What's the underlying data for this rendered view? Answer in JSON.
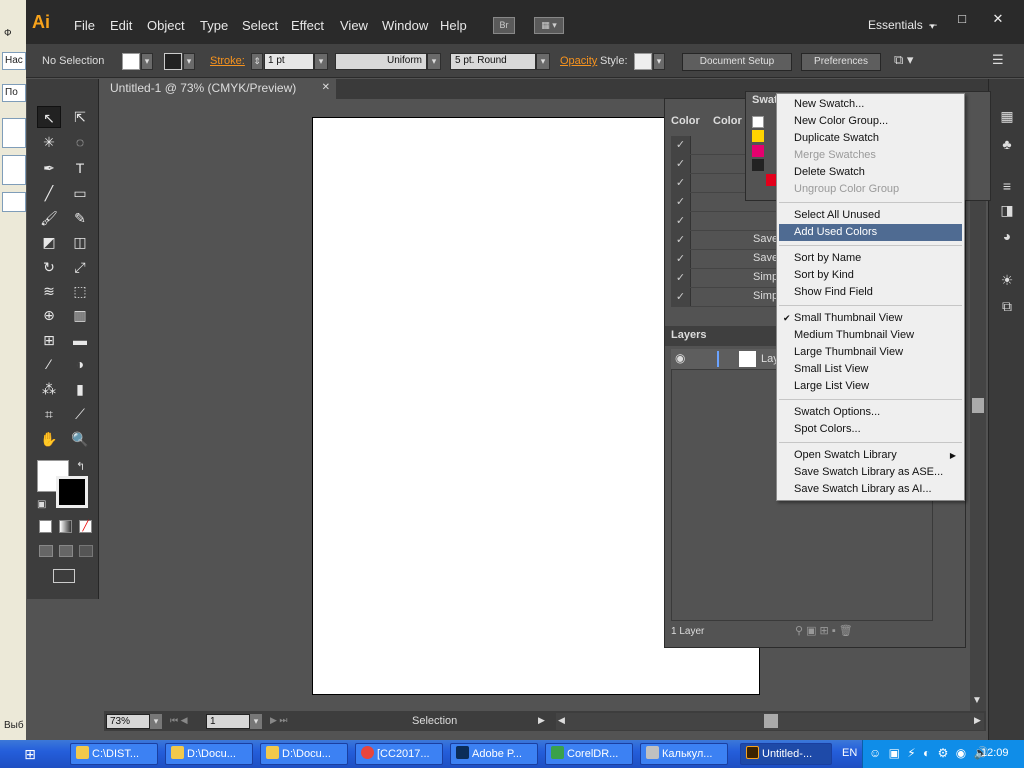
{
  "background_window": {
    "left_labels": [
      "Ф",
      "Нас",
      "По",
      "Выб"
    ]
  },
  "app": {
    "logo": "Ai",
    "menu": [
      "File",
      "Edit",
      "Object",
      "Type",
      "Select",
      "Effect",
      "View",
      "Window",
      "Help"
    ],
    "bridge_label": "Br",
    "workspace": "Essentials",
    "window_controls": [
      "_",
      "□",
      "✕"
    ]
  },
  "control_bar": {
    "selection": "No Selection",
    "stroke_label": "Stroke:",
    "stroke_value": "1 pt",
    "profile": "Uniform",
    "brush": "5 pt. Round",
    "opacity_label": "Opacity",
    "style_label": "Style:",
    "document_setup": "Document Setup",
    "preferences": "Preferences"
  },
  "document": {
    "tab_title": "Untitled-1 @ 73% (CMYK/Preview)",
    "close": "✕"
  },
  "status_bar": {
    "zoom": "73%",
    "page": "1",
    "tool": "Selection"
  },
  "panels": {
    "tab_color": "Color",
    "tab_color_guide": "Color",
    "tab_swatches": "Swat",
    "rows": [
      "",
      "",
      "",
      "",
      "",
      "Save",
      "Save",
      "Simp",
      "Simp"
    ],
    "layers_title": "Layers",
    "layer_name": "Lay",
    "layers_count": "1 Layer"
  },
  "context_menu": {
    "items": [
      {
        "label": "New Swatch...",
        "state": "normal"
      },
      {
        "label": "New Color Group...",
        "state": "normal"
      },
      {
        "label": "Duplicate Swatch",
        "state": "normal"
      },
      {
        "label": "Merge Swatches",
        "state": "disabled"
      },
      {
        "label": "Delete Swatch",
        "state": "normal"
      },
      {
        "label": "Ungroup Color Group",
        "state": "disabled"
      },
      {
        "label": "Select All Unused",
        "state": "normal"
      },
      {
        "label": "Add Used Colors",
        "state": "highlighted"
      },
      {
        "label": "Sort by Name",
        "state": "normal"
      },
      {
        "label": "Sort by Kind",
        "state": "normal"
      },
      {
        "label": "Show Find Field",
        "state": "normal"
      },
      {
        "label": "Small Thumbnail View",
        "state": "checked"
      },
      {
        "label": "Medium Thumbnail View",
        "state": "normal"
      },
      {
        "label": "Large Thumbnail View",
        "state": "normal"
      },
      {
        "label": "Small List View",
        "state": "normal"
      },
      {
        "label": "Large List View",
        "state": "normal"
      },
      {
        "label": "Swatch Options...",
        "state": "normal"
      },
      {
        "label": "Spot Colors...",
        "state": "normal"
      },
      {
        "label": "Open Swatch Library",
        "state": "submenu"
      },
      {
        "label": "Save Swatch Library as ASE...",
        "state": "normal"
      },
      {
        "label": "Save Swatch Library as AI...",
        "state": "normal"
      }
    ]
  },
  "taskbar": {
    "items": [
      {
        "label": "C:\\DIST...",
        "icon": "folder-icon",
        "color": "#f2c94c"
      },
      {
        "label": "D:\\Docu...",
        "icon": "folder-icon",
        "color": "#f2c94c"
      },
      {
        "label": "D:\\Docu...",
        "icon": "folder-icon",
        "color": "#f2c94c"
      },
      {
        "label": "[CC2017...",
        "icon": "chrome-icon",
        "color": "#e8453c"
      },
      {
        "label": "Adobe P...",
        "icon": "photoshop-icon",
        "color": "#0b2d59"
      },
      {
        "label": "CorelDR...",
        "icon": "coreldraw-icon",
        "color": "#3aa14a"
      },
      {
        "label": "Калькул...",
        "icon": "calculator-icon",
        "color": "#c0c0c0"
      },
      {
        "label": "Untitled-...",
        "icon": "illustrator-icon",
        "color": "#3b2200"
      }
    ],
    "lang": "EN",
    "clock": "12:09"
  }
}
